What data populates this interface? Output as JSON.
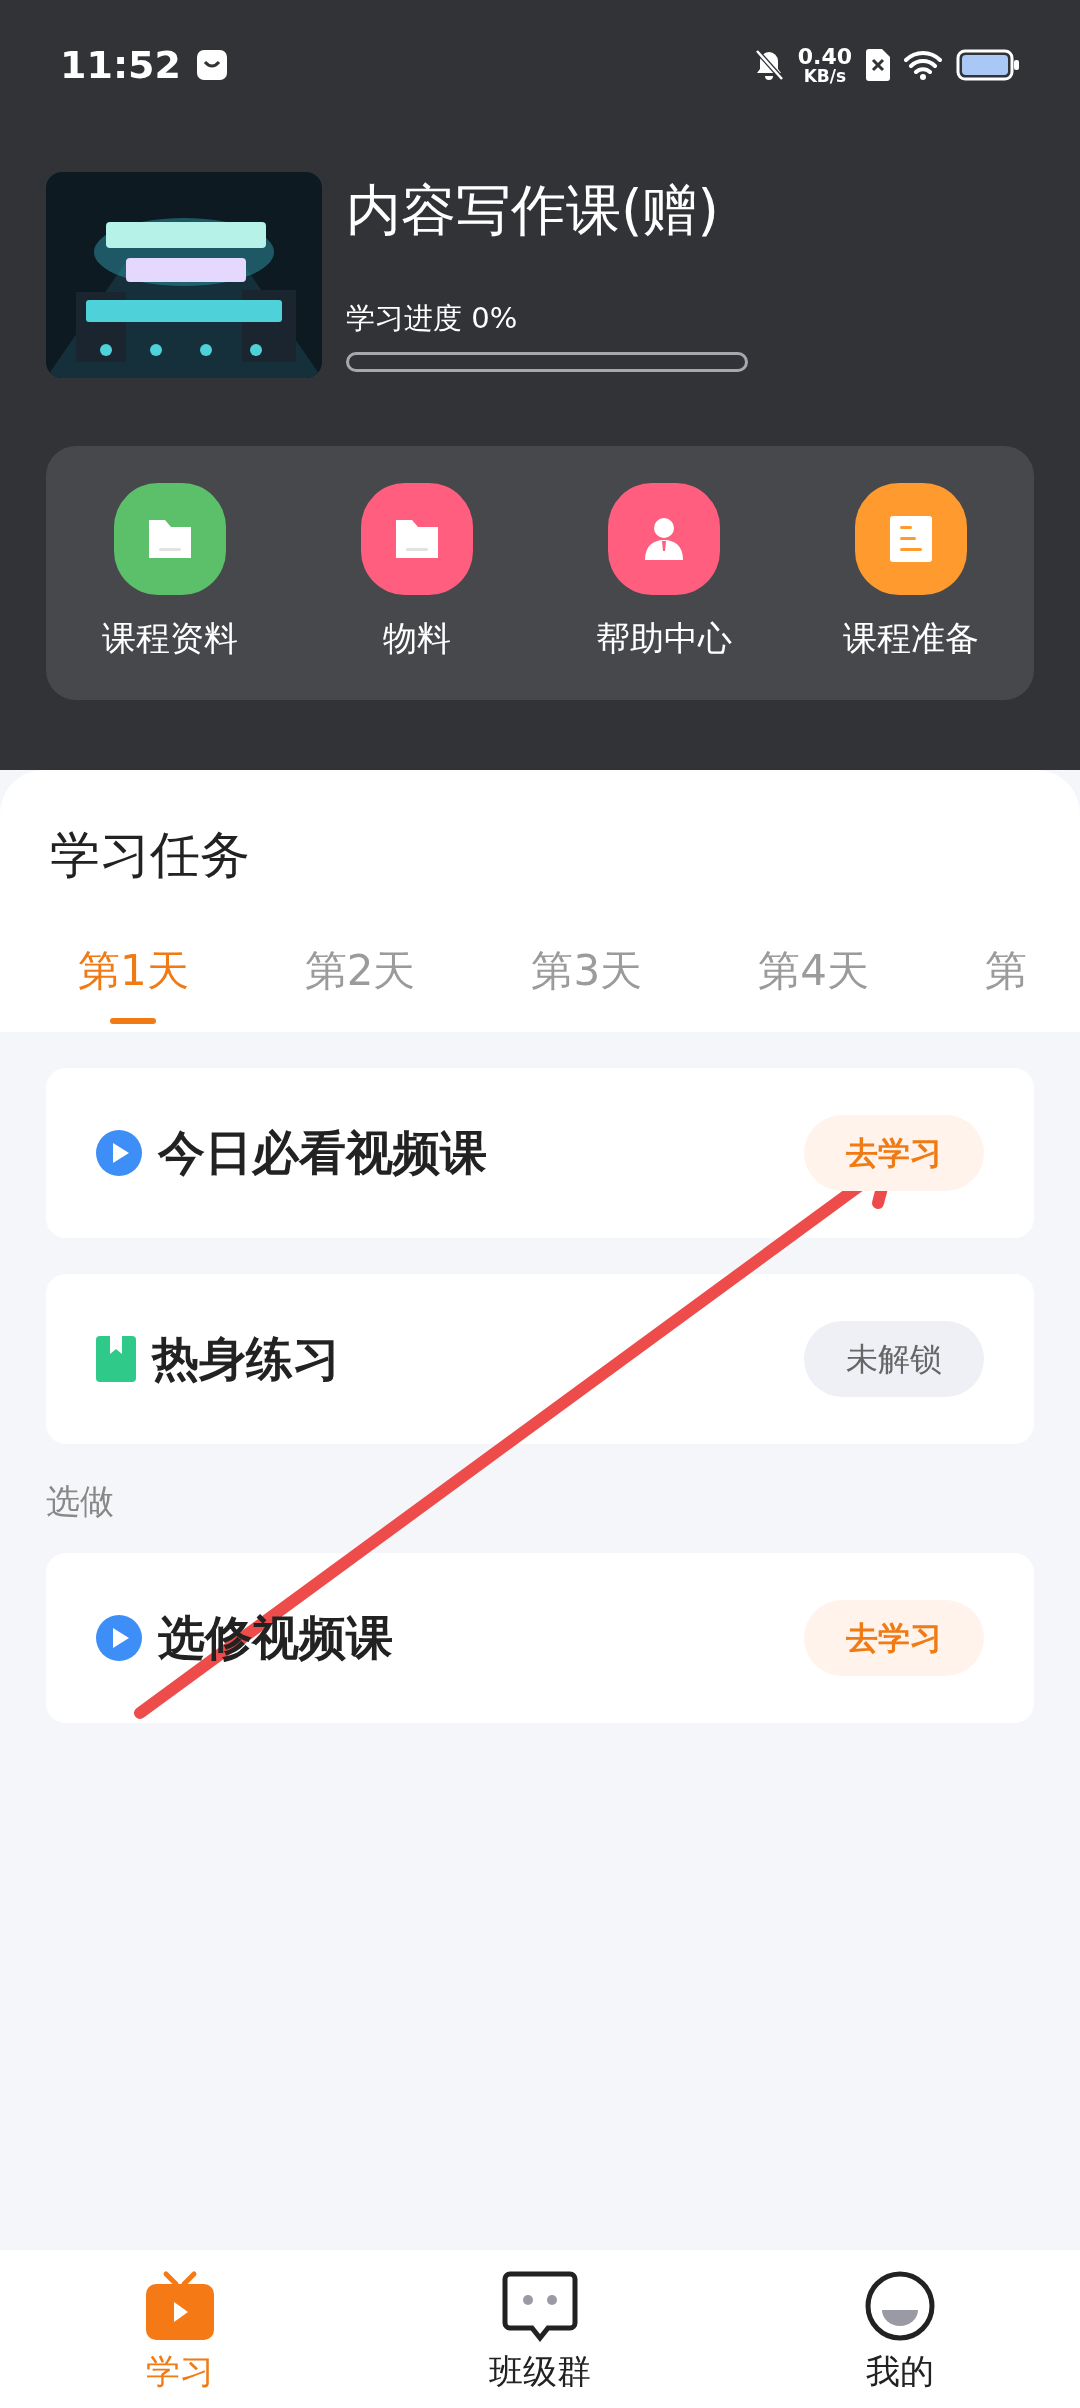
{
  "status_bar": {
    "time": "11:52",
    "speed_value": "0.40",
    "speed_unit": "KB/s"
  },
  "course": {
    "title": "内容写作课(赠)",
    "progress_label": "学习进度 0%",
    "level": 0
  },
  "shortcuts": [
    {
      "label": "课程资料",
      "kind": "folder",
      "color": "#5cc06b"
    },
    {
      "label": "物料",
      "kind": "folder",
      "color": "#ff5e7e"
    },
    {
      "label": "帮助中心",
      "kind": "person",
      "color": "#ff5e7e"
    },
    {
      "label": "课程准备",
      "kind": "document",
      "color": "#ff9a2e"
    }
  ],
  "tasks_title": "学习任务",
  "day_tabs": [
    {
      "label": "第1天",
      "selected": true
    },
    {
      "label": "第2天",
      "selected": false
    },
    {
      "label": "第3天",
      "selected": false
    },
    {
      "label": "第4天",
      "selected": false
    },
    {
      "label": "第",
      "selected": false
    }
  ],
  "tasks": [
    {
      "kind": "video",
      "title": "今日必看视频课",
      "action": "去学习",
      "locked": false
    },
    {
      "kind": "practice",
      "title": "热身练习",
      "action": "未解锁",
      "locked": true
    }
  ],
  "optional_label": "选做",
  "optional_tasks": [
    {
      "kind": "video",
      "title": "选修视频课",
      "action": "去学习",
      "locked": false
    }
  ],
  "annotation": {
    "kind": "arrow",
    "color": "#ee4b4b"
  },
  "bottom_nav": [
    {
      "label": "学习",
      "kind": "tv",
      "selected": true
    },
    {
      "label": "班级群",
      "kind": "chat",
      "selected": false
    },
    {
      "label": "我的",
      "kind": "face",
      "selected": false
    }
  ]
}
